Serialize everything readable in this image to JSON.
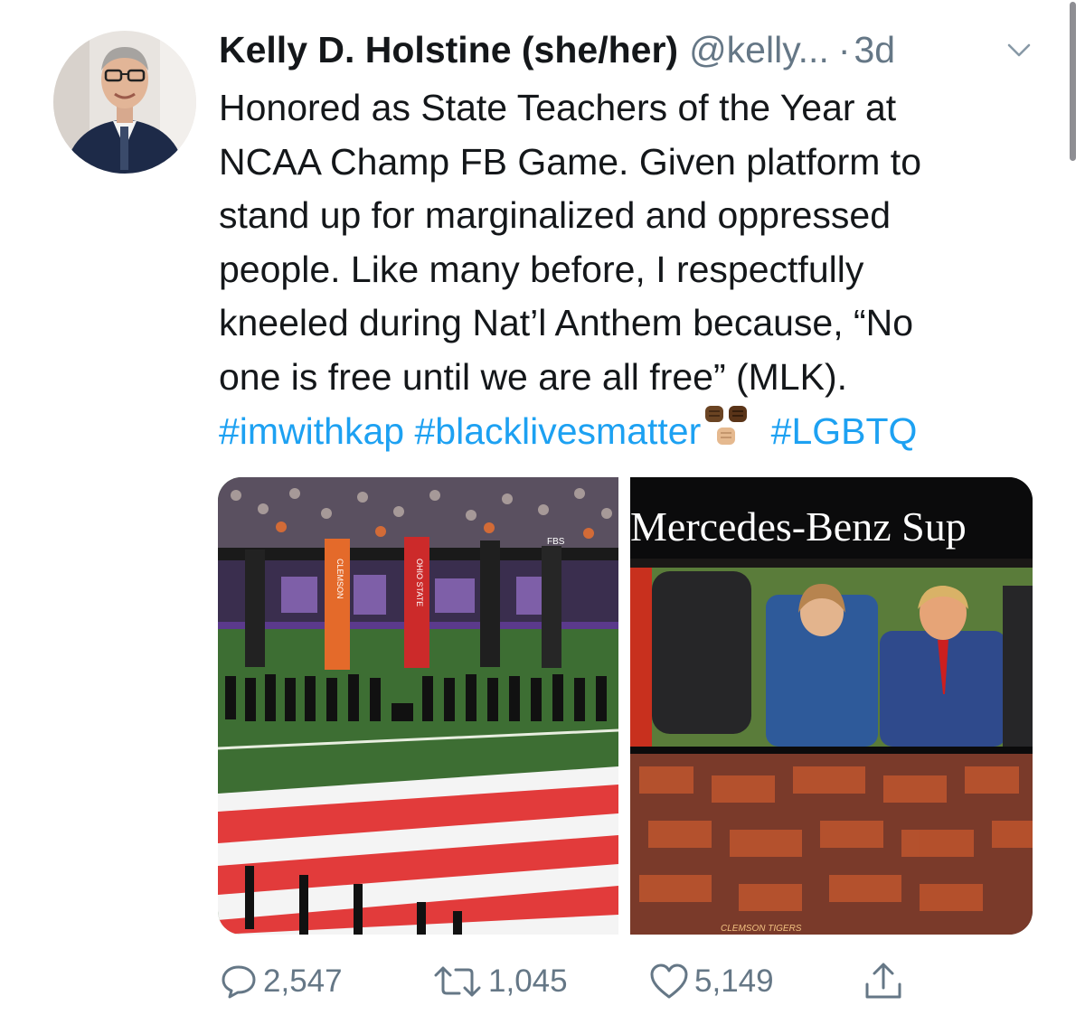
{
  "tweet": {
    "author_name": "Kelly D. Holstine (she/her)",
    "handle": "@kelly...",
    "separator": "·",
    "time": "3d",
    "text_lines": [
      "Honored as State Teachers of the Year at",
      "NCAA Champ FB Game. Given platform to",
      "stand up for marginalized and oppressed",
      "people. Like many before, I respectfully",
      "kneeled during Nat’l Anthem because, “No",
      "one is free until we are all free” (MLK)."
    ],
    "hashtags": [
      "#imwithkap",
      "#blacklivesmatter",
      "#LGBTQ"
    ],
    "photo_captions": {
      "scoreboard_banner": "Mercedes-Benz Sup",
      "banner_fbs": "FBS",
      "banner_clemson": "CLEMSON",
      "banner_ohio_state": "OHIO STATE",
      "ribbon": "CLEMSON TIGERS"
    }
  },
  "actions": {
    "replies": "2,547",
    "retweets": "1,045",
    "likes": "5,149"
  },
  "icons": [
    "verified-avatar",
    "chevron-down-icon",
    "reply-icon",
    "retweet-icon",
    "like-icon",
    "share-icon"
  ],
  "colors": {
    "hashtag": "#1da1f2",
    "secondary_text": "#657786",
    "text": "#14171a"
  }
}
